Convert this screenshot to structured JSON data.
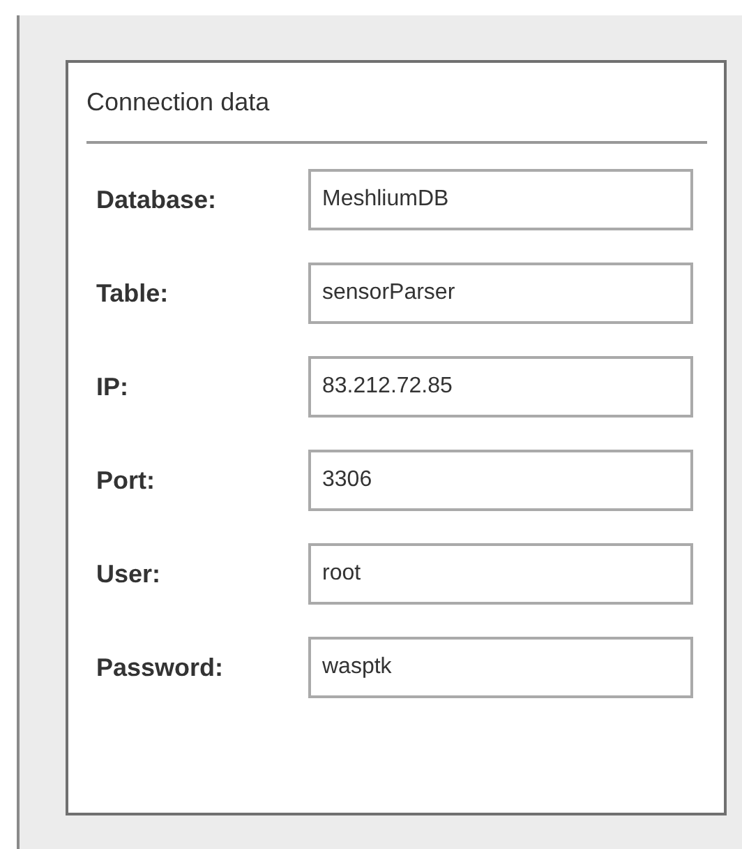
{
  "panel": {
    "title": "Connection data",
    "fields": [
      {
        "label": "Database:",
        "value": "MeshliumDB"
      },
      {
        "label": "Table:",
        "value": "sensorParser"
      },
      {
        "label": "IP:",
        "value": "83.212.72.85"
      },
      {
        "label": "Port:",
        "value": "3306"
      },
      {
        "label": "User:",
        "value": "root"
      },
      {
        "label": "Password:",
        "value": "wasptk"
      }
    ]
  }
}
